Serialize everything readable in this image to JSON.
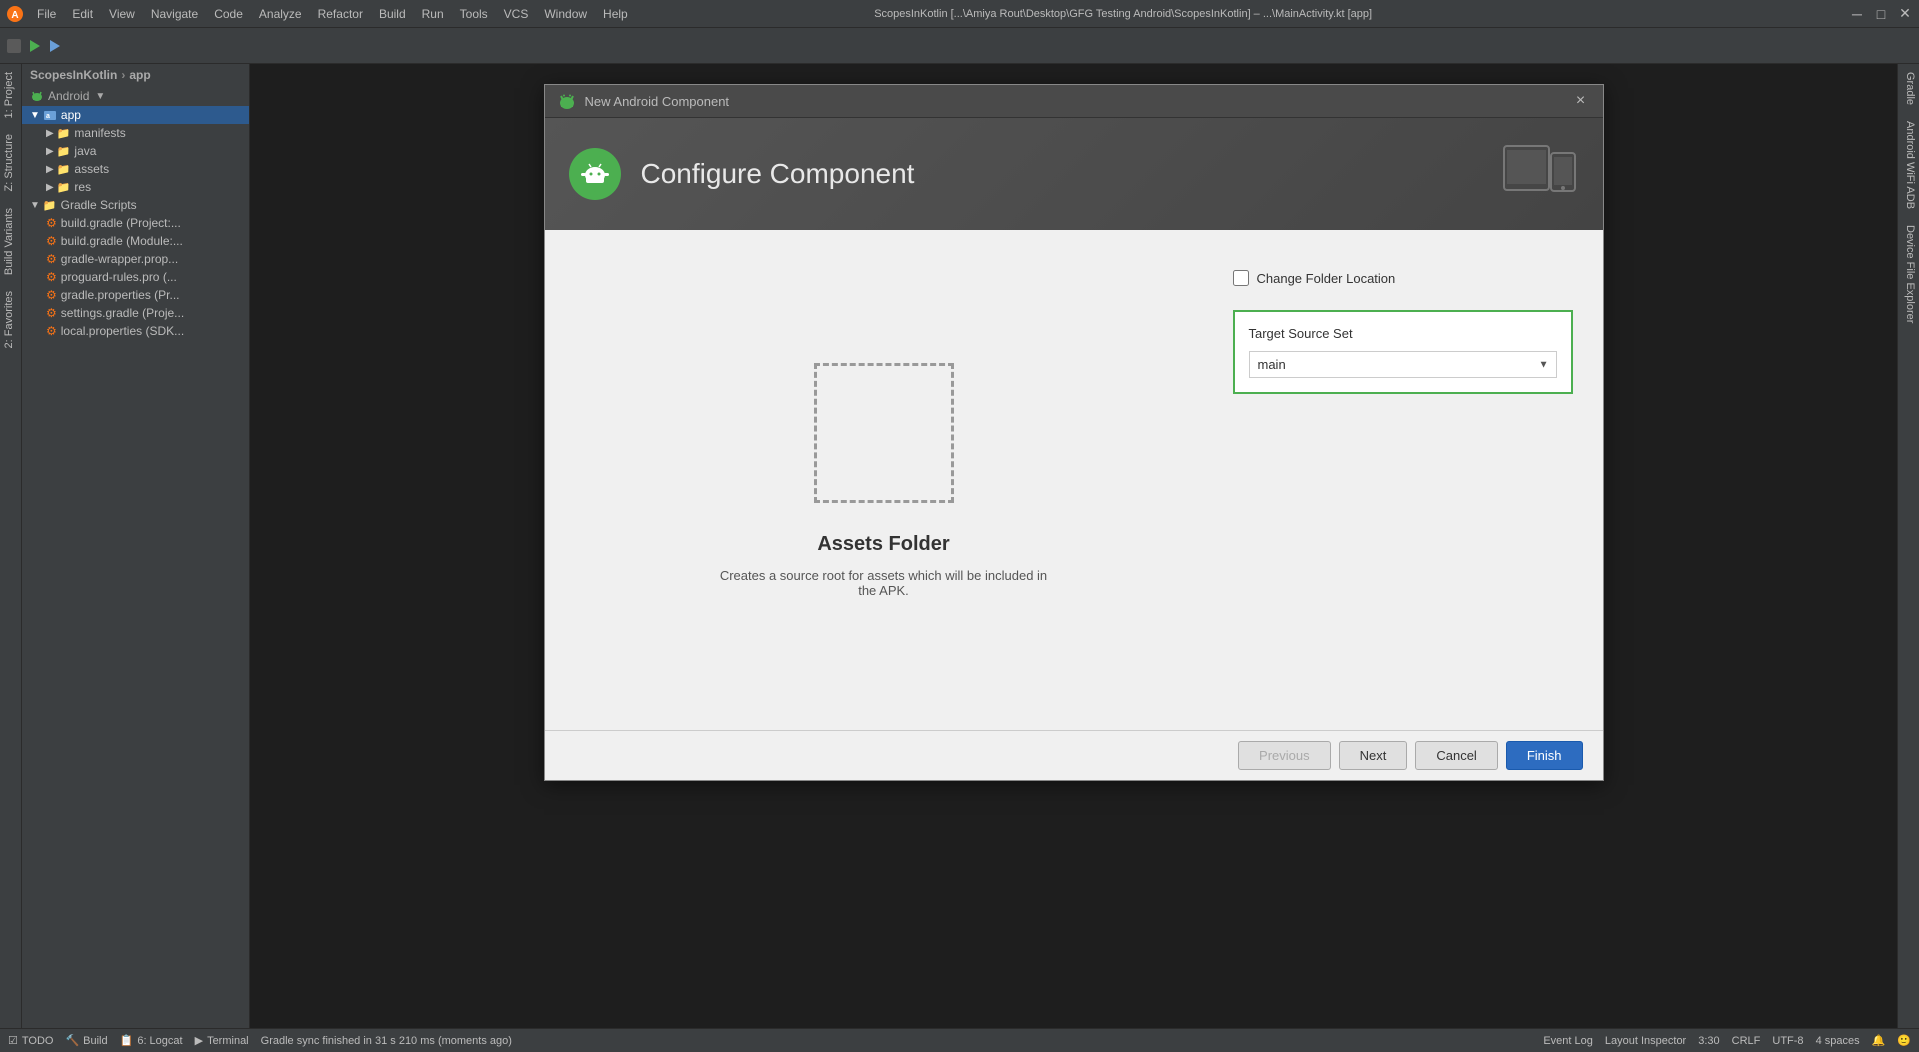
{
  "app": {
    "title": "ScopesInKotlin [...\\Amiya Rout\\Desktop\\GFG Testing Android\\ScopesInKotlin] – ...\\MainActivity.kt [app]"
  },
  "menu": {
    "items": [
      "File",
      "Edit",
      "View",
      "Navigate",
      "Code",
      "Analyze",
      "Refactor",
      "Build",
      "Run",
      "Tools",
      "VCS",
      "Window",
      "Help"
    ]
  },
  "sidebar": {
    "project_name": "ScopesInKotlin",
    "module_name": "app",
    "android_label": "Android",
    "items": [
      {
        "label": "app",
        "indent": 0,
        "type": "module"
      },
      {
        "label": "manifests",
        "indent": 1,
        "type": "folder"
      },
      {
        "label": "java",
        "indent": 1,
        "type": "folder"
      },
      {
        "label": "assets",
        "indent": 1,
        "type": "folder"
      },
      {
        "label": "res",
        "indent": 1,
        "type": "folder"
      },
      {
        "label": "Gradle Scripts",
        "indent": 0,
        "type": "folder"
      },
      {
        "label": "build.gradle (Project:...",
        "indent": 1,
        "type": "gradle"
      },
      {
        "label": "build.gradle (Module:...",
        "indent": 1,
        "type": "gradle"
      },
      {
        "label": "gradle-wrapper.prop...",
        "indent": 1,
        "type": "gradle"
      },
      {
        "label": "proguard-rules.pro (...",
        "indent": 1,
        "type": "gradle"
      },
      {
        "label": "gradle.properties (Pr...",
        "indent": 1,
        "type": "gradle"
      },
      {
        "label": "settings.gradle (Proje...",
        "indent": 1,
        "type": "gradle"
      },
      {
        "label": "local.properties (SDK...",
        "indent": 1,
        "type": "gradle"
      }
    ]
  },
  "left_tabs": [
    "1: Project",
    "2: Favorites",
    "Z: Structure",
    "Build Variants"
  ],
  "right_tabs": [
    "Gradle",
    "Android WiFi ADB",
    "Device File Explorer"
  ],
  "dialog": {
    "title": "New Android Component",
    "close_label": "×",
    "header_title": "Configure Component",
    "checkbox_label": "Change Folder Location",
    "target_source_set": {
      "label": "Target Source Set",
      "value": "main",
      "options": [
        "main"
      ]
    },
    "component_title": "Assets Folder",
    "component_desc": "Creates a source root for assets which will be included in the APK.",
    "footer": {
      "previous_label": "Previous",
      "next_label": "Next",
      "cancel_label": "Cancel",
      "finish_label": "Finish"
    }
  },
  "status_bar": {
    "message": "Gradle sync finished in 31 s 210 ms (moments ago)",
    "position": "3:30",
    "encoding": "CRLF",
    "charset": "UTF-8",
    "indent": "4 spaces",
    "right_items": [
      "Event Log",
      "Layout Inspector"
    ]
  }
}
